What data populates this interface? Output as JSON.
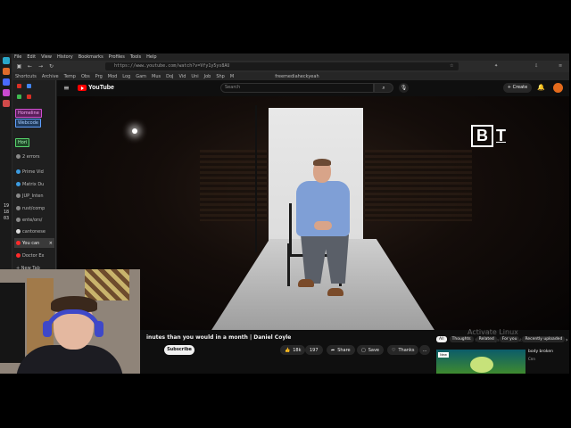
{
  "menubar": [
    "File",
    "Edit",
    "View",
    "History",
    "Bookmarks",
    "Profiles",
    "Tools",
    "Help"
  ],
  "url": "https://www.youtube.com/watch?v=Vfy1y5ys8AU",
  "bookmarks": [
    "Shortcuts",
    "Archive",
    "Temp",
    "Obs",
    "Prg",
    "Mod",
    "Log",
    "Gam",
    "Mus",
    "DoJ",
    "Vid",
    "Uni",
    "Job",
    "Shp",
    "M"
  ],
  "bookmark_right": "freemediaheckyeah",
  "sidebar": {
    "tags": [
      {
        "label": "Homeline",
        "color": "#d14fd1"
      },
      {
        "label": "Webcode",
        "color": "#5fa0ff"
      },
      {
        "label": "Hori",
        "color": "#56d36b"
      }
    ],
    "tabs": [
      {
        "label": "2 errors",
        "fav": "#888888",
        "active": false
      },
      {
        "label": "Prime Vid",
        "fav": "#3c9be0",
        "active": false
      },
      {
        "label": "Matrix Du",
        "fav": "#3c9be0",
        "active": false
      },
      {
        "label": "JUP_Inten",
        "fav": "#888888",
        "active": false
      },
      {
        "label": "rust/comp",
        "fav": "#888888",
        "active": false
      },
      {
        "label": "ente/ors/",
        "fav": "#888888",
        "active": false
      },
      {
        "label": "cantonese",
        "fav": "#dddddd",
        "active": false
      },
      {
        "label": "You can",
        "fav": "#ff2a2a",
        "active": true
      },
      {
        "label": "Doctor Ex",
        "fav": "#ff2a2a",
        "active": false
      },
      {
        "label": "+ New Tab",
        "fav": "",
        "active": false
      }
    ]
  },
  "clock": [
    "19",
    "18",
    "03"
  ],
  "youtube": {
    "logo_text": "YouTube",
    "search_placeholder": "Search",
    "create_label": "+ Create",
    "video_title": "inutes than you would in a month | Daniel Coyle",
    "subscribe_label": "Subscribe",
    "like_count": "18k",
    "dislike_count": "197",
    "share_label": "Share",
    "save_label": "Save",
    "thanks_label": "Thanks",
    "more_label": "...",
    "watermark_b": "B",
    "watermark_t": "T",
    "chips": [
      "All",
      "Thoughts",
      "Related",
      "For you",
      "Recently uploaded"
    ],
    "rec_badge": "New",
    "rec_title": "body broken",
    "rec_channel": "Cnn"
  },
  "activate": {
    "title": "Activate Linux",
    "subtitle": "Go to Settings to activate Linux."
  }
}
